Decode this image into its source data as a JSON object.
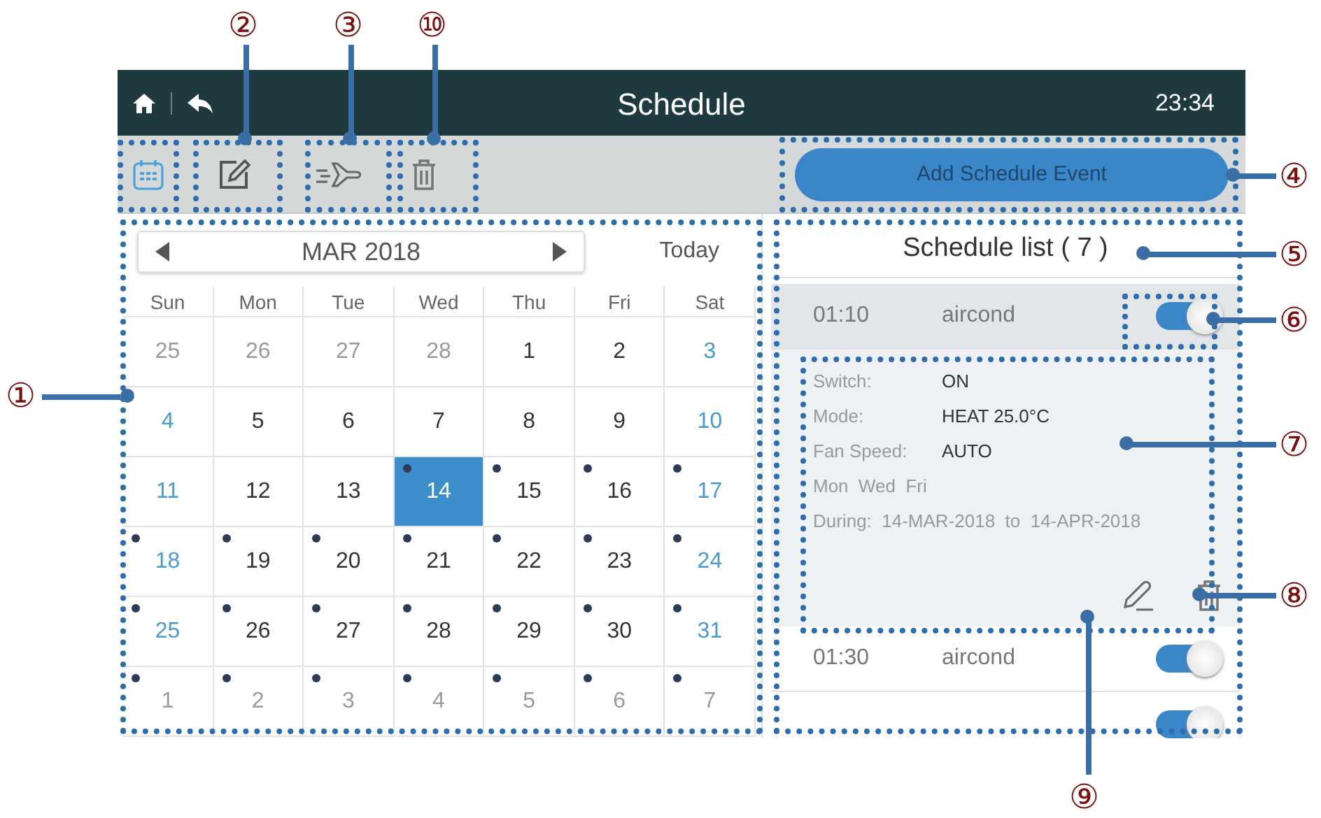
{
  "header": {
    "title": "Schedule",
    "time": "23:34"
  },
  "toolbar": {
    "add_button": "Add Schedule Event"
  },
  "calendar": {
    "month": "MAR 2018",
    "today_button": "Today",
    "weekdays": [
      "Sun",
      "Mon",
      "Tue",
      "Wed",
      "Thu",
      "Fri",
      "Sat"
    ],
    "days": [
      {
        "label": "25",
        "kind": "other",
        "selected": false,
        "event": false
      },
      {
        "label": "26",
        "kind": "other",
        "selected": false,
        "event": false
      },
      {
        "label": "27",
        "kind": "other",
        "selected": false,
        "event": false
      },
      {
        "label": "28",
        "kind": "other",
        "selected": false,
        "event": false
      },
      {
        "label": "1",
        "kind": "weekday",
        "selected": false,
        "event": false
      },
      {
        "label": "2",
        "kind": "weekday",
        "selected": false,
        "event": false
      },
      {
        "label": "3",
        "kind": "weekend",
        "selected": false,
        "event": false
      },
      {
        "label": "4",
        "kind": "weekend",
        "selected": false,
        "event": false
      },
      {
        "label": "5",
        "kind": "weekday",
        "selected": false,
        "event": false
      },
      {
        "label": "6",
        "kind": "weekday",
        "selected": false,
        "event": false
      },
      {
        "label": "7",
        "kind": "weekday",
        "selected": false,
        "event": false
      },
      {
        "label": "8",
        "kind": "weekday",
        "selected": false,
        "event": false
      },
      {
        "label": "9",
        "kind": "weekday",
        "selected": false,
        "event": false
      },
      {
        "label": "10",
        "kind": "weekend",
        "selected": false,
        "event": false
      },
      {
        "label": "11",
        "kind": "weekend",
        "selected": false,
        "event": false
      },
      {
        "label": "12",
        "kind": "weekday",
        "selected": false,
        "event": false
      },
      {
        "label": "13",
        "kind": "weekday",
        "selected": false,
        "event": false
      },
      {
        "label": "14",
        "kind": "weekday",
        "selected": true,
        "event": true
      },
      {
        "label": "15",
        "kind": "weekday",
        "selected": false,
        "event": true
      },
      {
        "label": "16",
        "kind": "weekday",
        "selected": false,
        "event": true
      },
      {
        "label": "17",
        "kind": "weekend",
        "selected": false,
        "event": true
      },
      {
        "label": "18",
        "kind": "weekend",
        "selected": false,
        "event": true
      },
      {
        "label": "19",
        "kind": "weekday",
        "selected": false,
        "event": true
      },
      {
        "label": "20",
        "kind": "weekday",
        "selected": false,
        "event": true
      },
      {
        "label": "21",
        "kind": "weekday",
        "selected": false,
        "event": true
      },
      {
        "label": "22",
        "kind": "weekday",
        "selected": false,
        "event": true
      },
      {
        "label": "23",
        "kind": "weekday",
        "selected": false,
        "event": true
      },
      {
        "label": "24",
        "kind": "weekend",
        "selected": false,
        "event": true
      },
      {
        "label": "25",
        "kind": "weekend",
        "selected": false,
        "event": true
      },
      {
        "label": "26",
        "kind": "weekday",
        "selected": false,
        "event": true
      },
      {
        "label": "27",
        "kind": "weekday",
        "selected": false,
        "event": true
      },
      {
        "label": "28",
        "kind": "weekday",
        "selected": false,
        "event": true
      },
      {
        "label": "29",
        "kind": "weekday",
        "selected": false,
        "event": true
      },
      {
        "label": "30",
        "kind": "weekday",
        "selected": false,
        "event": true
      },
      {
        "label": "31",
        "kind": "weekend",
        "selected": false,
        "event": true
      },
      {
        "label": "1",
        "kind": "other",
        "selected": false,
        "event": true
      },
      {
        "label": "2",
        "kind": "other",
        "selected": false,
        "event": true
      },
      {
        "label": "3",
        "kind": "other",
        "selected": false,
        "event": true
      },
      {
        "label": "4",
        "kind": "other",
        "selected": false,
        "event": true
      },
      {
        "label": "5",
        "kind": "other",
        "selected": false,
        "event": true
      },
      {
        "label": "6",
        "kind": "other",
        "selected": false,
        "event": true
      },
      {
        "label": "7",
        "kind": "other",
        "selected": false,
        "event": true
      }
    ]
  },
  "schedule_list": {
    "title": "Schedule list ( 7 )",
    "items": [
      {
        "time": "01:10",
        "device": "aircond",
        "on": true,
        "expanded": true,
        "details": {
          "fields": [
            {
              "label": "Switch:",
              "value": "ON"
            },
            {
              "label": "Mode:",
              "value": "HEAT  25.0°C"
            },
            {
              "label": "Fan Speed:",
              "value": "AUTO"
            }
          ],
          "days": "Mon  Wed  Fri",
          "during": "During:  14-MAR-2018  to  14-APR-2018"
        }
      },
      {
        "time": "01:30",
        "device": "aircond",
        "on": true,
        "expanded": false
      },
      {
        "on": true,
        "expanded": false
      }
    ]
  },
  "callouts": [
    {
      "label": "①"
    },
    {
      "label": "②"
    },
    {
      "label": "③"
    },
    {
      "label": "⑩"
    },
    {
      "label": "④"
    },
    {
      "label": "⑤"
    },
    {
      "label": "⑥"
    },
    {
      "label": "⑦"
    },
    {
      "label": "⑧"
    },
    {
      "label": "⑨"
    }
  ]
}
